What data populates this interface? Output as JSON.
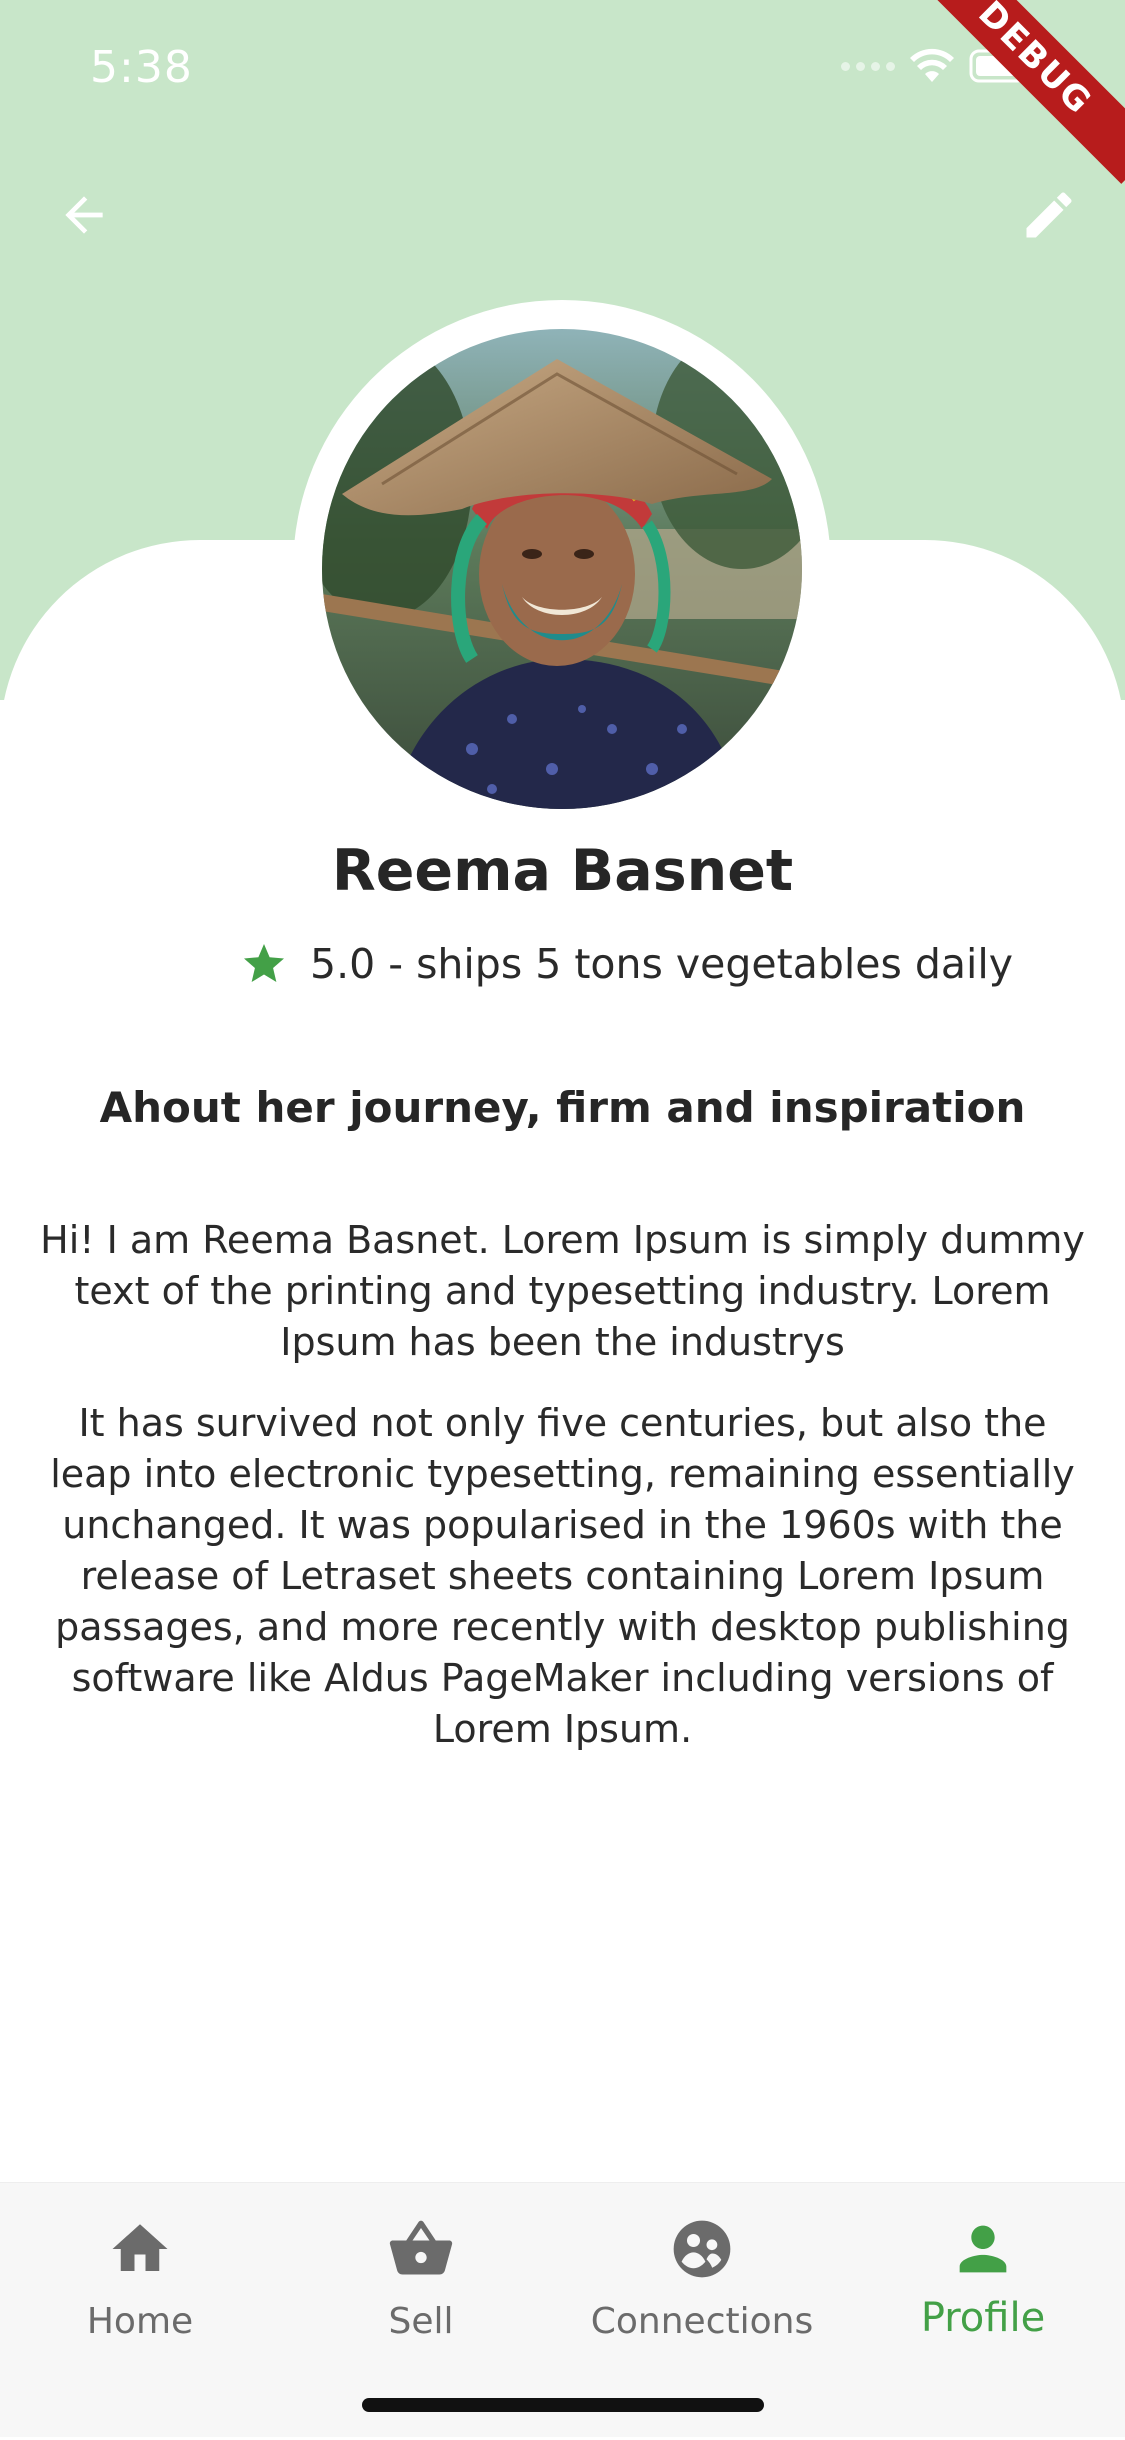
{
  "status_bar": {
    "time": "5:38",
    "debug_label": "DEBUG"
  },
  "header": {
    "background_color": "#c8e6c9",
    "back_icon": "arrow-left-icon",
    "edit_icon": "pencil-icon"
  },
  "profile": {
    "name": "Reema Basnet",
    "rating_icon": "star-icon",
    "rating_text": "5.0 - ships 5 tons vegetables daily",
    "star_color": "#43a047"
  },
  "about": {
    "heading": "Ahout her journey, firm and inspiration",
    "paragraphs": [
      "Hi! I am Reema Basnet. Lorem Ipsum is simply dummy text of the printing and typesetting industry. Lorem Ipsum has been the industrys",
      "It has survived not only five centuries, but also the leap into electronic typesetting, remaining essentially unchanged. It was popularised in the 1960s with the release of Letraset sheets containing Lorem Ipsum passages, and more recently with desktop publishing software like Aldus PageMaker including versions of Lorem Ipsum."
    ]
  },
  "bottom_nav": {
    "accent_color": "#43a047",
    "items": [
      {
        "label": "Home",
        "icon": "home-icon",
        "active": false
      },
      {
        "label": "Sell",
        "icon": "basket-icon",
        "active": false
      },
      {
        "label": "Connections",
        "icon": "connections-icon",
        "active": false
      },
      {
        "label": "Profile",
        "icon": "person-icon",
        "active": true
      }
    ]
  }
}
